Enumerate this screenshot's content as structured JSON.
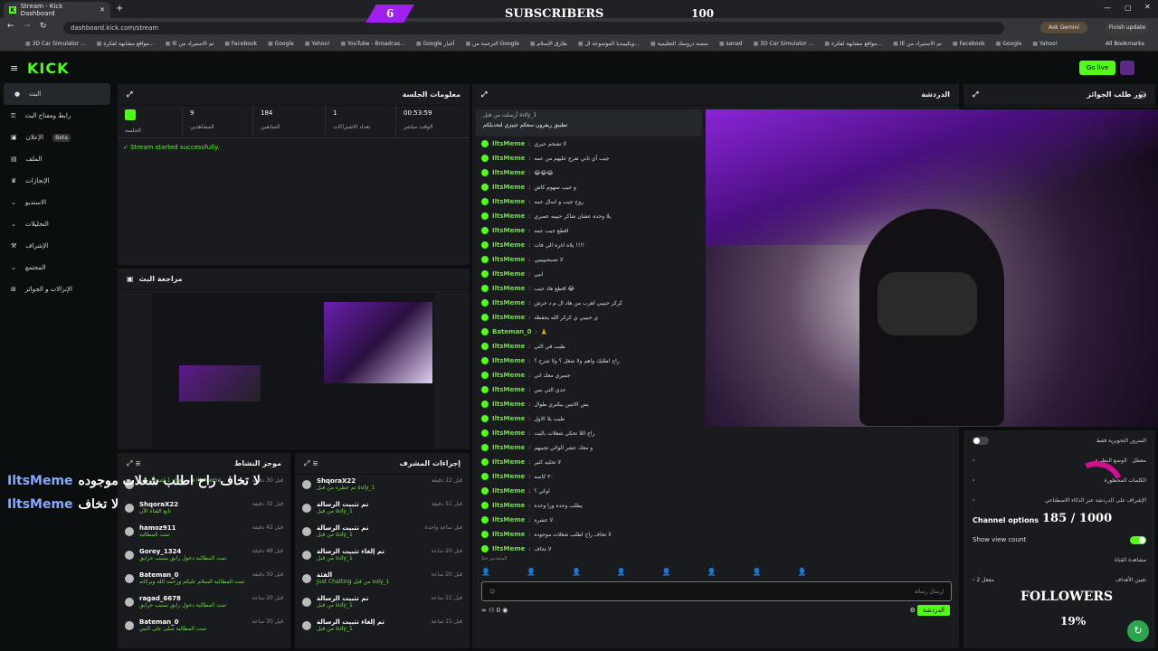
{
  "browser": {
    "tab_title": "Stream - Kick Dashboard",
    "url": "dashboard.kick.com/stream",
    "ask_gemini": "Ask Gemini",
    "finish_update": "Finish update",
    "bookmarks": [
      "3D Car Simulator ...",
      "مواقع مشابهة لفكرة...",
      "IE تم الاستيراد من",
      "Facebook",
      "Google",
      "Yahoo!",
      "YouTube - Broadcas...",
      "Google أخبار",
      "الترجمة من Google",
      "طارق الإسلام",
      "ويكيبيديا الموسوعة ال...",
      "منصة دروسك التعليمية",
      "sanad",
      "3D Car Simulator ...",
      "مواقع مشابهة لفكرة...",
      "IE تم الاستيراد من",
      "Facebook",
      "Google",
      "Yahoo!"
    ],
    "all_bookmarks": "All Bookmarks"
  },
  "overlay": {
    "count_left": "6",
    "subscribers": "SUBSCRIBERS",
    "count_right": "100",
    "followers_count": "185 / 1000",
    "followers": "FOLLOWERS",
    "followers_pct": "19%",
    "msg1_user": "IltsMeme",
    "msg1_text": "لا تخاف راح اطلب شغلات موجوده",
    "msg2_user": "IltsMeme",
    "msg2_text": "لا تخاف"
  },
  "app": {
    "logo": "KICK",
    "go_live": "Go live"
  },
  "sidebar": [
    "البث",
    "رابط ومفتاح البث",
    "الإعلان",
    "الملف",
    "الإنجازات",
    "الاستديو",
    "التحليلات",
    "الإشراف",
    "المجتمع",
    "الإنزالات و الجوائز"
  ],
  "sidebar_beta": "Beta",
  "session": {
    "title": "معلومات الجلسة",
    "live_label": "الجلسة",
    "stats": [
      {
        "v": "9",
        "l": "المشاهدين"
      },
      {
        "v": "184",
        "l": "المتابعين"
      },
      {
        "v": "1",
        "l": "تعداد الاشتراكات"
      },
      {
        "v": "00:53:59",
        "l": "الوقت مباشر"
      }
    ],
    "success": "Stream started successfully."
  },
  "preview": {
    "title": "مراجعة البث"
  },
  "activity": {
    "title": "موجز النشاط",
    "items": [
      {
        "name": "",
        "sub": "قام بإهداء 1 اشتراك إلى IltsMeme",
        "time": "قبل 30 دقيقة"
      },
      {
        "name": "ShqoraX22",
        "sub": "تابع القناة الآن",
        "time": "قبل 32 دقيقة"
      },
      {
        "name": "hamoz911",
        "sub": "تمت المطالبة",
        "time": "قبل 42 دقيقة"
      },
      {
        "name": "Gorey_1324",
        "sub": "تمت المطالبة دخول رايق بسبب حرابق",
        "time": "قبل 48 دقيقة"
      },
      {
        "name": "Bateman_0",
        "sub": "تمت المطالبة السلام عليكم ورحمه الله وبركاته",
        "time": "قبل 50 دقيقة"
      },
      {
        "name": "ragad_6678",
        "sub": "تمت المطالبة دخول رايق بسبب حرابق",
        "time": "قبل 20 ساعة"
      },
      {
        "name": "Bateman_0",
        "sub": "تمت المطالبة صلى على النبي",
        "time": "قبل 20 ساعة"
      }
    ]
  },
  "modactions": {
    "title": "إجراءات المشرف",
    "items": [
      {
        "name": "ShqoraX22",
        "sub": "تم حظره من قبل suly_1",
        "time": "قبل 12 دقيقة"
      },
      {
        "name": "تم تثبيت الرسالة",
        "sub": "من قبل suly_1",
        "time": "قبل 51 دقيقة"
      },
      {
        "name": "تم تثبيت الرسالة",
        "sub": "من قبل suly_1",
        "time": "قبل ساعة واحدة"
      },
      {
        "name": "تم إلغاء تثبيت الرسالة",
        "sub": "من قبل suly_1",
        "time": "قبل 20 ساعة"
      },
      {
        "name": "الفئة",
        "sub": "Just Chatting من قبل suly_1",
        "time": "قبل 20 ساعة"
      },
      {
        "name": "تم تثبيت الرسالة",
        "sub": "من قبل suly_1",
        "time": "قبل 21 ساعة"
      },
      {
        "name": "تم إلغاء تثبيت الرسالة",
        "sub": "من قبل suly_1",
        "time": "قبل 21 ساعة"
      }
    ]
  },
  "chat": {
    "title": "الدردشة",
    "pinned_by": "أرسلت من قبل suly_1",
    "pinned_text": "تطبيق ريفرون سعكم جيبزي لتحديلكم",
    "lines": [
      {
        "u": "IltsMeme",
        "t": "لا تشخم حيري"
      },
      {
        "u": "IltsMeme",
        "t": "جيب أي ثاني تفرع عليهم من عمه"
      },
      {
        "u": "IltsMeme",
        "t": "😂😂😂"
      },
      {
        "u": "IltsMeme",
        "t": "و جيب سهوم كاش"
      },
      {
        "u": "IltsMeme",
        "t": "روح جيب و اسال عمه"
      },
      {
        "u": "IltsMeme",
        "t": "يلا وحده عشان شاكر حبيبه عصري"
      },
      {
        "u": "IltsMeme",
        "t": "اقطع جيب عمه"
      },
      {
        "u": "IltsMeme",
        "t": "يلاه اغره الي فات !!!!"
      },
      {
        "u": "IltsMeme",
        "t": "لا تصبحيييييي"
      },
      {
        "u": "IltsMeme",
        "t": "ابيي"
      },
      {
        "u": "IltsMeme",
        "t": "اقطع هاد جيب 😂"
      },
      {
        "u": "IltsMeme",
        "t": "كركر حبيبي اهرب من هاد ال م د حرش"
      },
      {
        "u": "IltsMeme",
        "t": "ي حبيبي ي كركر الله يحفظه"
      },
      {
        "u": "Bateman_0",
        "t": "🙏"
      },
      {
        "u": "IltsMeme",
        "t": "طيب في الثي"
      },
      {
        "u": "IltsMeme",
        "t": "راح اطلبك واهم ولا شغل ؟ ولا شرح ؟"
      },
      {
        "u": "IltsMeme",
        "t": "جميري معك اني"
      },
      {
        "u": "IltsMeme",
        "t": "حدي الثي بس"
      },
      {
        "u": "IltsMeme",
        "t": "بس الاثنين بيكبري طوال"
      },
      {
        "u": "IltsMeme",
        "t": "طيب يلا الاول"
      },
      {
        "u": "IltsMeme",
        "t": "راح اللا تحكي شغلات باليت"
      },
      {
        "u": "IltsMeme",
        "t": "و معك عشر الوائي تجيبهم"
      },
      {
        "u": "IltsMeme",
        "t": "لا تخليه كثير"
      },
      {
        "u": "IltsMeme",
        "t": "٣٠ كاسه"
      },
      {
        "u": "IltsMeme",
        "t": "اوكي ؟"
      },
      {
        "u": "IltsMeme",
        "t": "يطلب وحده ورا وحده"
      },
      {
        "u": "IltsMeme",
        "t": "لا عشره"
      },
      {
        "u": "IltsMeme",
        "t": "لا تخاف راح اطلب شغلات موجوده"
      },
      {
        "u": "IltsMeme",
        "t": "لا تخاف"
      }
    ],
    "chatters_label": "المتحدثين قبلا",
    "input_placeholder": "إرسال رسالة",
    "send": "الدردشة",
    "viewers": "0"
  },
  "rewards": {
    "title": "دور طلب الجوائز"
  },
  "options": {
    "emote_only": "السرور التحويرية فقط",
    "slow_mode": "الوضع البطيء",
    "slow_value": "معطل",
    "blocked_words": "الكلمات المحظورة",
    "ai_moderation": "الإشراف على الدردشة عبر الذكاء الاصطناعي",
    "channel_options": "Channel options",
    "show_view_count": "Show view count",
    "channel_share": "مشاهدة القناة",
    "goals": "تعيين الأهداف",
    "goals_value": "مفعل 2"
  },
  "colors": {
    "accent": "#53fc18",
    "purple": "#a020f0"
  }
}
